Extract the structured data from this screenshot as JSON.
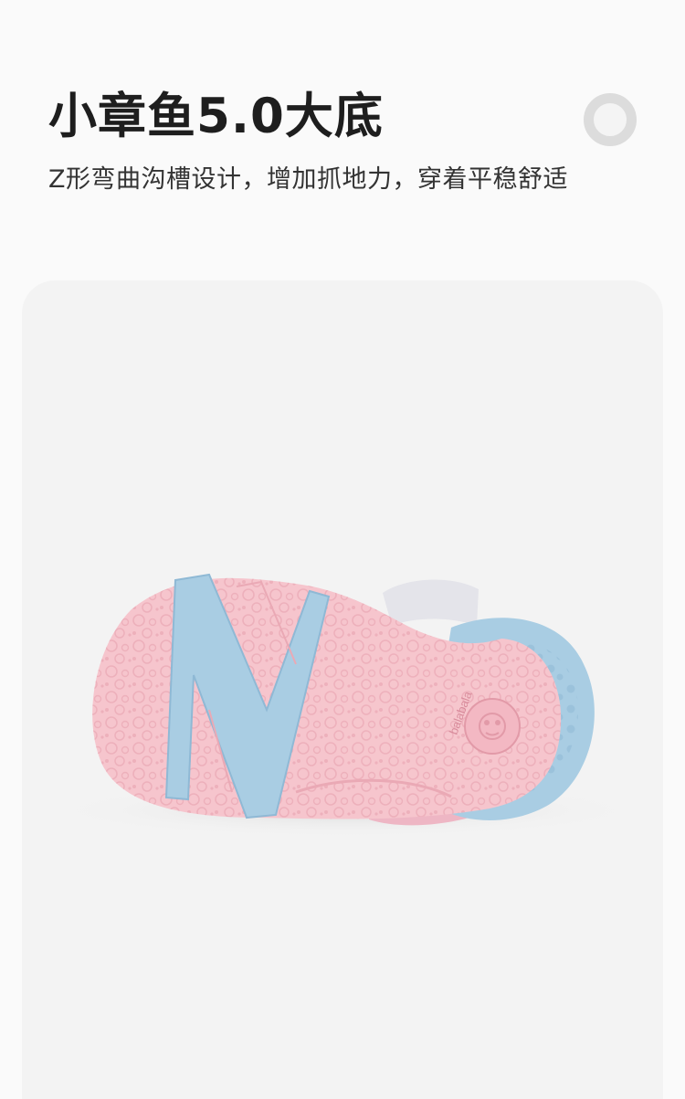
{
  "header": {
    "title": "小章鱼5.0大底",
    "subtitle": "Z形弯曲沟槽设计，增加抓地力，穿着平稳舒适"
  },
  "product": {
    "brand_logo_text": "balabala",
    "colors": {
      "sole_pink": "#f6c5cd",
      "sole_blue": "#a9cde3",
      "background": "#f3f3f3"
    }
  }
}
